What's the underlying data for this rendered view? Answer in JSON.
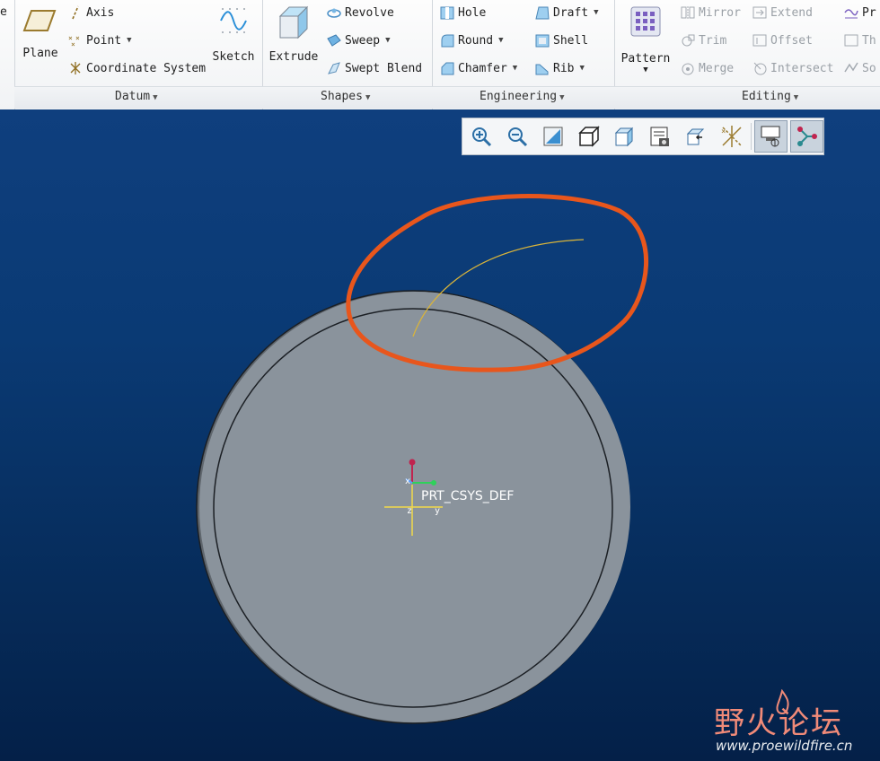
{
  "ribbon": {
    "datum": {
      "group_label": "Datum",
      "plane": "Plane",
      "axis": "Axis",
      "point": "Point",
      "coordinate_system": "Coordinate System",
      "sketch": "Sketch"
    },
    "shapes": {
      "group_label": "Shapes",
      "extrude": "Extrude",
      "revolve": "Revolve",
      "sweep": "Sweep",
      "swept_blend": "Swept Blend"
    },
    "engineering": {
      "group_label": "Engineering",
      "hole": "Hole",
      "round": "Round",
      "chamfer": "Chamfer",
      "draft": "Draft",
      "shell": "Shell",
      "rib": "Rib"
    },
    "editing": {
      "group_label": "Editing",
      "pattern": "Pattern",
      "mirror": "Mirror",
      "trim": "Trim",
      "merge": "Merge",
      "extend": "Extend",
      "offset": "Offset",
      "intersect": "Intersect",
      "pr": "Pr",
      "th": "Th",
      "so": "So"
    },
    "left_cut_letter": "e"
  },
  "view_toolbar": {
    "buttons": [
      "zoom-in",
      "zoom-out",
      "refit",
      "named-views",
      "saved-orientations",
      "appearance-gallery",
      "view-manager",
      "display-style",
      "datum-display",
      "spin-center"
    ],
    "active": [
      "datum-display",
      "spin-center"
    ]
  },
  "viewport": {
    "csys_label": "PRT_CSYS_DEF",
    "axis_x": "x",
    "axis_y": "y",
    "axis_z": "z"
  },
  "watermark": {
    "cn": "野火论坛",
    "url": "www.proewildfire.cn"
  },
  "colors": {
    "part_face": "#8a939c",
    "part_rim": "#5f666d",
    "curve": "#d9b43a",
    "highlight_annotation": "#e8561c"
  }
}
